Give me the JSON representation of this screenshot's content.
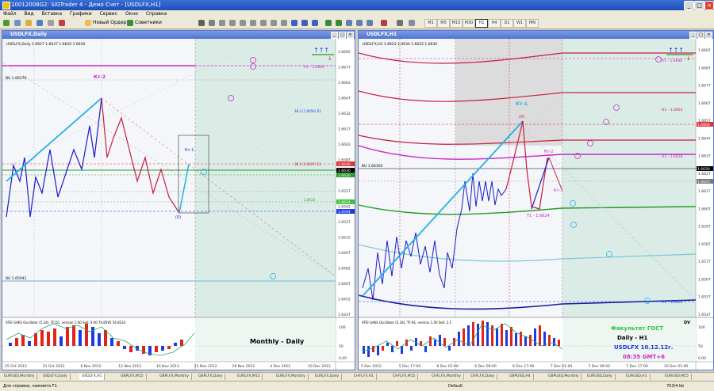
{
  "window": {
    "title": "10012008G2: SIGTrader 4 - Демо Счет - [USDLFX,H1]"
  },
  "menu": [
    "Файл",
    "Вид",
    "Вставка",
    "Графики",
    "Сервис",
    "Окно",
    "Справка"
  ],
  "toolbar": {
    "new_order": "Новый Ордер",
    "advisors": "Советники"
  },
  "timeframes": [
    "M1",
    "M5",
    "M15",
    "M30",
    "H1",
    "H4",
    "D1",
    "W1",
    "MN"
  ],
  "left_chart": {
    "window_title": "USDLFX,Daily",
    "header": "USDLFX,Daily  1.6627 1.6637 1.6620 1.6630",
    "labels": {
      "kt2": "Кт-2",
      "kt1": "Кт-1",
      "zero": "(0)",
      "r1": "R1 - 1.6660",
      "bu1": "BU 1.66370",
      "bu2": "BU 1.65941"
    },
    "fib_labels": [
      "38.2 (1.6656) R1",
      "38.2 (1.6607) S1",
      "1.6614"
    ],
    "price_ticks": [
      "1.6692",
      "1.6677",
      "1.6662",
      "1.6647",
      "1.6632",
      "1.6617",
      "1.6602",
      "1.6587",
      "1.6572",
      "1.6557",
      "1.6542",
      "1.6527",
      "1.6512",
      "1.6497",
      "1.6482",
      "1.6467",
      "1.6452",
      "1.6437"
    ],
    "price_tags": [
      "1.6640",
      "1.6630",
      "1.6620",
      "1.6614",
      "1.6594"
    ],
    "indicator_label": "ATEI GAKS Oscillator (5,34), TF:D1, version 1.00   Sell: 0.00  70.8595 54.8233",
    "osc_ticks": [
      "100",
      "50",
      "0.00"
    ],
    "overlay_text": "Monthly - Daily",
    "dates": [
      "25 Oct 2012",
      "31 Oct 2012",
      "6 Nov 2012",
      "12 Nov 2012",
      "16 Nov 2012",
      "22 Nov 2012",
      "28 Nov 2012",
      "4 Dec 2012",
      "10 Dec 2012"
    ]
  },
  "right_chart": {
    "window_title": "USDLFX,H1",
    "header": "USDLFX,H1  1.6623 1.6634 1.6622 1.6630",
    "labels": {
      "kt1": "Кт-1",
      "zero": "(0)",
      "kt2": "Кт-2",
      "kt3": "Кт-3",
      "t1": "Т1 - 1.6624",
      "r1": "R1 - 1.6696",
      "h1a": "H1 - 1.6663",
      "h1b": "H1 - 1.6638",
      "bu": "BU 1.66305",
      "h1c": "H1 - 1.6551"
    },
    "price_ticks": [
      "1.6697",
      "1.6687",
      "1.6677",
      "1.6667",
      "1.6657",
      "1.6647",
      "1.6637",
      "1.6627",
      "1.6617",
      "1.6607",
      "1.6597",
      "1.6587",
      "1.6577",
      "1.6567",
      "1.6557",
      "1.6547"
    ],
    "price_tags": [
      "1.6666",
      "1.6630",
      "1.6623"
    ],
    "indicator_label": "ATEI GAKS Oscillator (5,34), TF:H1, version 1.00   Sell: 2.1",
    "osc_ticks": [
      "100",
      "50",
      "0.00"
    ],
    "overlay": {
      "faculty": "Факультет ГОСТ",
      "tf": "Daily - H1",
      "symbol": "USDLFX 10.12.12г.",
      "time": "08:35  GMT+6",
      "dv": "DV"
    },
    "dates": [
      "5 Dec 2012",
      "5 Dec 17:00",
      "6 Dec 01:00",
      "6 Dec 09:00",
      "6 Dec 17:00",
      "7 Dec 01:00",
      "7 Dec 09:00",
      "7 Dec 17:00",
      "10 Dec 01:00"
    ]
  },
  "tabs": [
    "EURUSD,Monthly",
    "USDLFX,Daily",
    "USDLFX,H1",
    "GBPLFX,M15",
    "GBPLFX,Monthly",
    "GBPLFX,Daily",
    "EURLFX,M15",
    "EURLFX,Monthly",
    "EURLFX,Daily",
    "CHFLFX,H1",
    "CHFLFX,M15",
    "CHFLFX,Monthly",
    "CHFLFX,Daily",
    "GBPUSD,H4",
    "GBPUSD,Monthly",
    "EURUSD,Daily",
    "EURUSD,H1",
    "EURUSD,M15"
  ],
  "active_tab": "USDLFX,H1",
  "status": {
    "help": "Для справки, нажмите F1",
    "profile": "Default",
    "traffic": "703/4 kb"
  },
  "colors": {
    "bull": "#1c1cc8",
    "bear": "#c81c3c",
    "teal_up": "#23b0e6",
    "osc_blue": "#1a3ce0",
    "osc_red": "#e0241a",
    "osc_line": "#2aa07a",
    "magenta": "#c828c8"
  }
}
